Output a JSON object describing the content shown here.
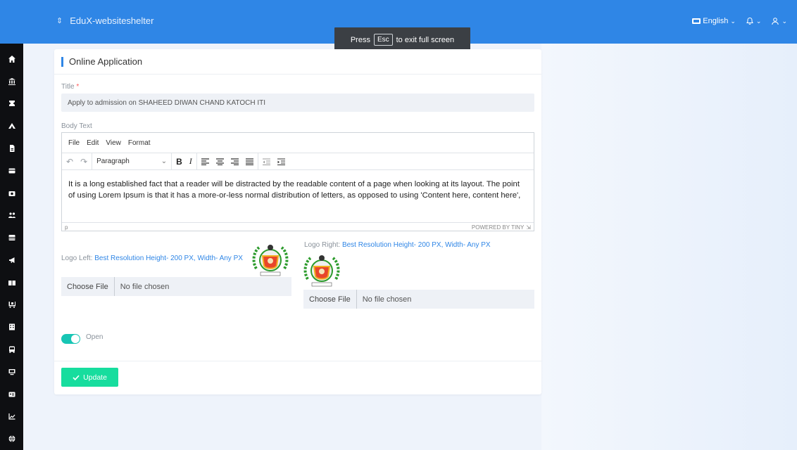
{
  "app": {
    "brand": "EduX-websiteshelter",
    "language": "English"
  },
  "fullscreen_hint": {
    "press": "Press",
    "key": "Esc",
    "suffix": "to exit full screen"
  },
  "sidebar": {
    "icons": [
      "home-icon",
      "institution-icon",
      "graduation-cap-icon",
      "road-icon",
      "file-icon",
      "credit-card-icon",
      "camera-icon",
      "users-icon",
      "list-icon",
      "megaphone-icon",
      "book-icon",
      "cart-icon",
      "building-icon",
      "bus-icon",
      "monitor-icon",
      "id-card-icon",
      "chart-icon",
      "globe-icon"
    ]
  },
  "card": {
    "title": "Online Application",
    "title_label": "Title",
    "required_mark": "*",
    "title_value": "Apply to admission on SHAHEED DIWAN CHAND KATOCH ITI",
    "body_label": "Body Text",
    "editor": {
      "menu": [
        "File",
        "Edit",
        "View",
        "Format"
      ],
      "format_select": "Paragraph",
      "content_line1": "It is a long established fact that a reader will be distracted by the readable content of a page when looking at its layout. The point",
      "content_line2": "of using Lorem Ipsum is that it has a more-or-less normal distribution of letters, as opposed to using 'Content here, content here',",
      "path": "p",
      "powered": "POWERED BY TINY"
    },
    "logo_left": {
      "label": "Logo Left:",
      "hint": "Best Resolution Height- 200 PX, Width- Any PX",
      "choose": "Choose File",
      "nofile": "No file chosen"
    },
    "logo_right": {
      "label": "Logo Right:",
      "hint": "Best Resolution Height- 200 PX, Width- Any PX",
      "choose": "Choose File",
      "nofile": "No file chosen"
    },
    "toggle_label": "Open",
    "toggle_on": true,
    "update": "Update"
  },
  "colors": {
    "topbar": "#2f86e6",
    "sidebar": "#0e0f12",
    "accent_toggle": "#17c5b4",
    "update_button": "#17dd9e"
  }
}
